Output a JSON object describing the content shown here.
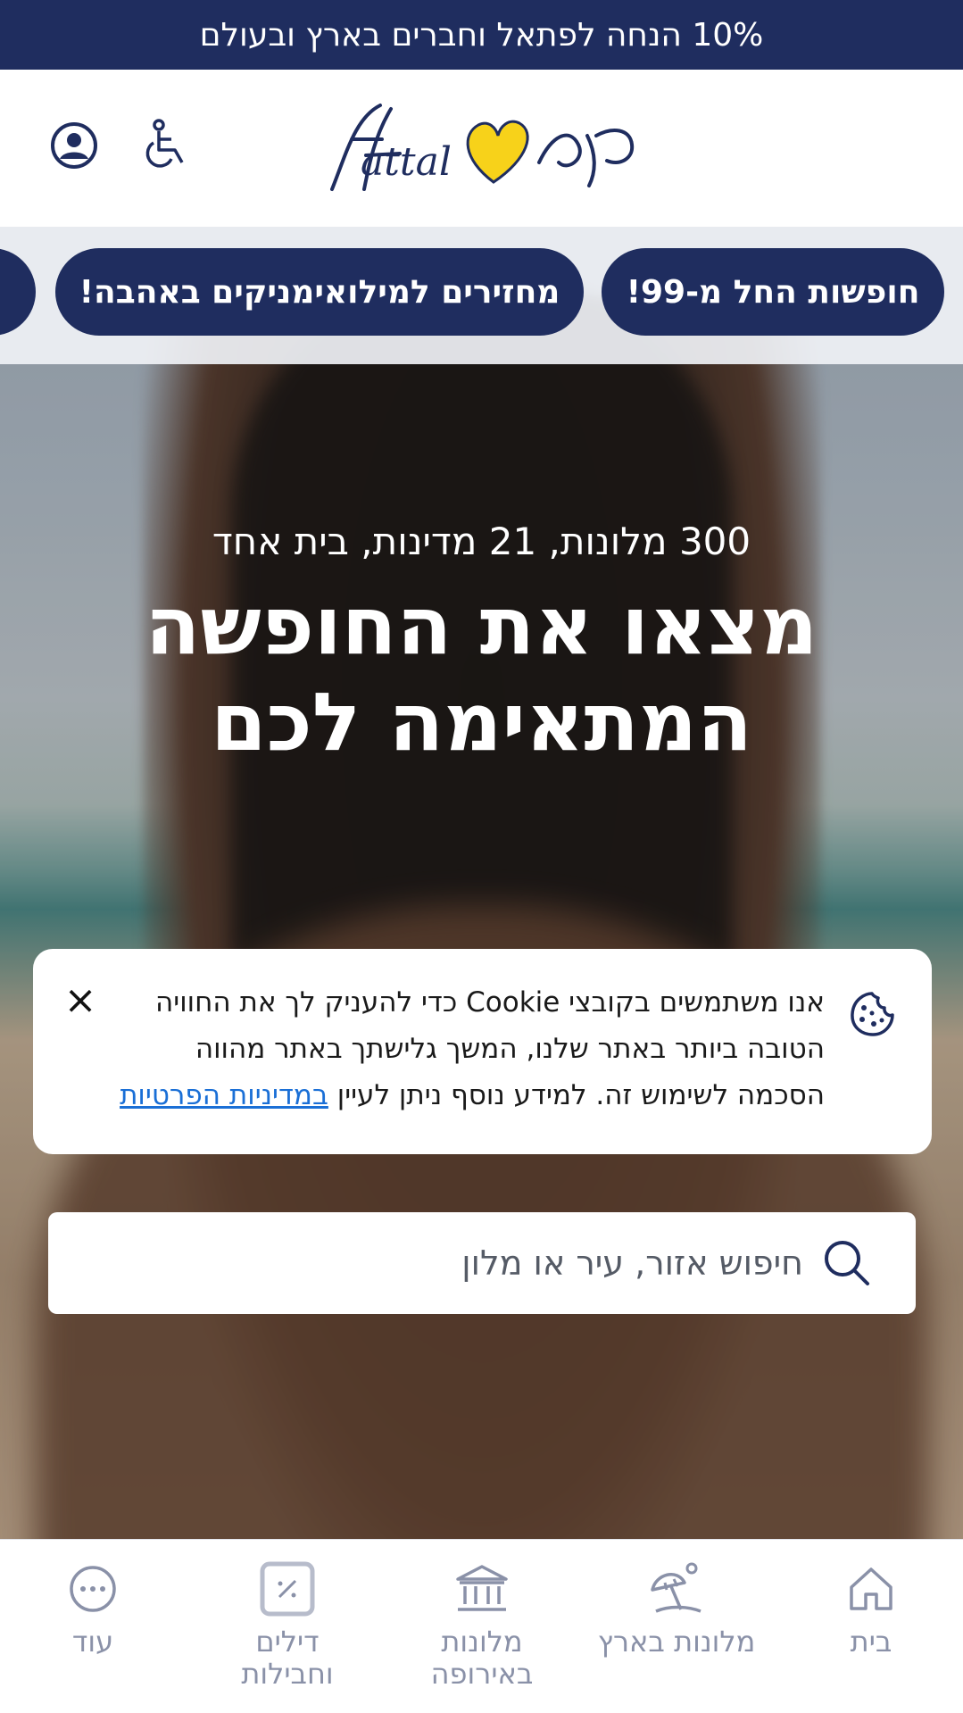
{
  "promo": {
    "text": "10% הנחה לפתאל וחברים בארץ ובעולם"
  },
  "header": {
    "logo_text": "fattal פתאל",
    "accessibility_icon": "wheelchair-icon",
    "account_icon": "user-circle-icon"
  },
  "chips": [
    {
      "label": "חופשות החל מ-99!"
    },
    {
      "label": "מחזירים למילואימניקים באהבה!"
    }
  ],
  "hero": {
    "subtitle": "300 מלונות, 21 מדינות, בית אחד",
    "title_line1": "מצאו את החופשה",
    "title_line2": "המתאימה לכם"
  },
  "cookie": {
    "text_main": "אנו משתמשים בקובצי Cookie כדי להעניק לך את החוויה הטובה ביותר באתר שלנו, המשך גלישתך באתר מהווה הסכמה לשימוש זה. למידע נוסף ניתן לעיין ",
    "link_text": "במדיניות הפרטיות",
    "close_glyph": "×"
  },
  "search": {
    "placeholder": "חיפוש אזור, עיר או מלון"
  },
  "bottom_nav": [
    {
      "label": "בית",
      "icon": "home-icon"
    },
    {
      "label": "מלונות בארץ",
      "icon": "beach-umbrella-icon"
    },
    {
      "label": "מלונות באירופה",
      "icon": "bank-building-icon"
    },
    {
      "label": "דילים וחבילות",
      "icon": "percent-tag-icon"
    },
    {
      "label": "עוד",
      "icon": "more-dots-icon"
    }
  ],
  "colors": {
    "brand_navy": "#1f2d5f",
    "brand_yellow": "#f7d21a",
    "link_blue": "#1a6fd6",
    "nav_gray": "#8a91a8"
  }
}
